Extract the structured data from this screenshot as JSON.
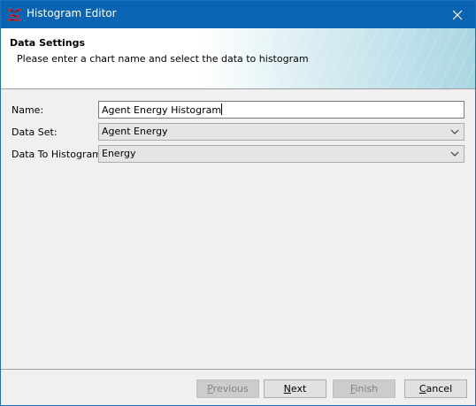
{
  "window": {
    "title": "Histogram Editor",
    "app_icon": "repast-app-icon",
    "close_icon": "close-icon"
  },
  "header": {
    "title": "Data Settings",
    "description": "Please enter a chart name and select the data to histogram"
  },
  "form": {
    "name": {
      "label": "Name:",
      "value": "Agent Energy Histogram"
    },
    "data_set": {
      "label": "Data Set:",
      "value": "Agent Energy"
    },
    "data_to_histogram": {
      "label": "Data To Histogram:",
      "value": "Energy"
    }
  },
  "buttons": {
    "previous": {
      "label_mnemonic": "P",
      "label_rest": "revious",
      "enabled": false
    },
    "next": {
      "label_mnemonic": "N",
      "label_rest": "ext",
      "enabled": true
    },
    "finish": {
      "label_mnemonic": "F",
      "label_rest": "inish",
      "enabled": false
    },
    "cancel": {
      "label_mnemonic": "C",
      "label_rest": "ancel",
      "enabled": true
    }
  },
  "colors": {
    "titlebar": "#0a64b4",
    "header_gradient_end": "#a9d6e3",
    "dialog_bg": "#f0f0f0"
  }
}
